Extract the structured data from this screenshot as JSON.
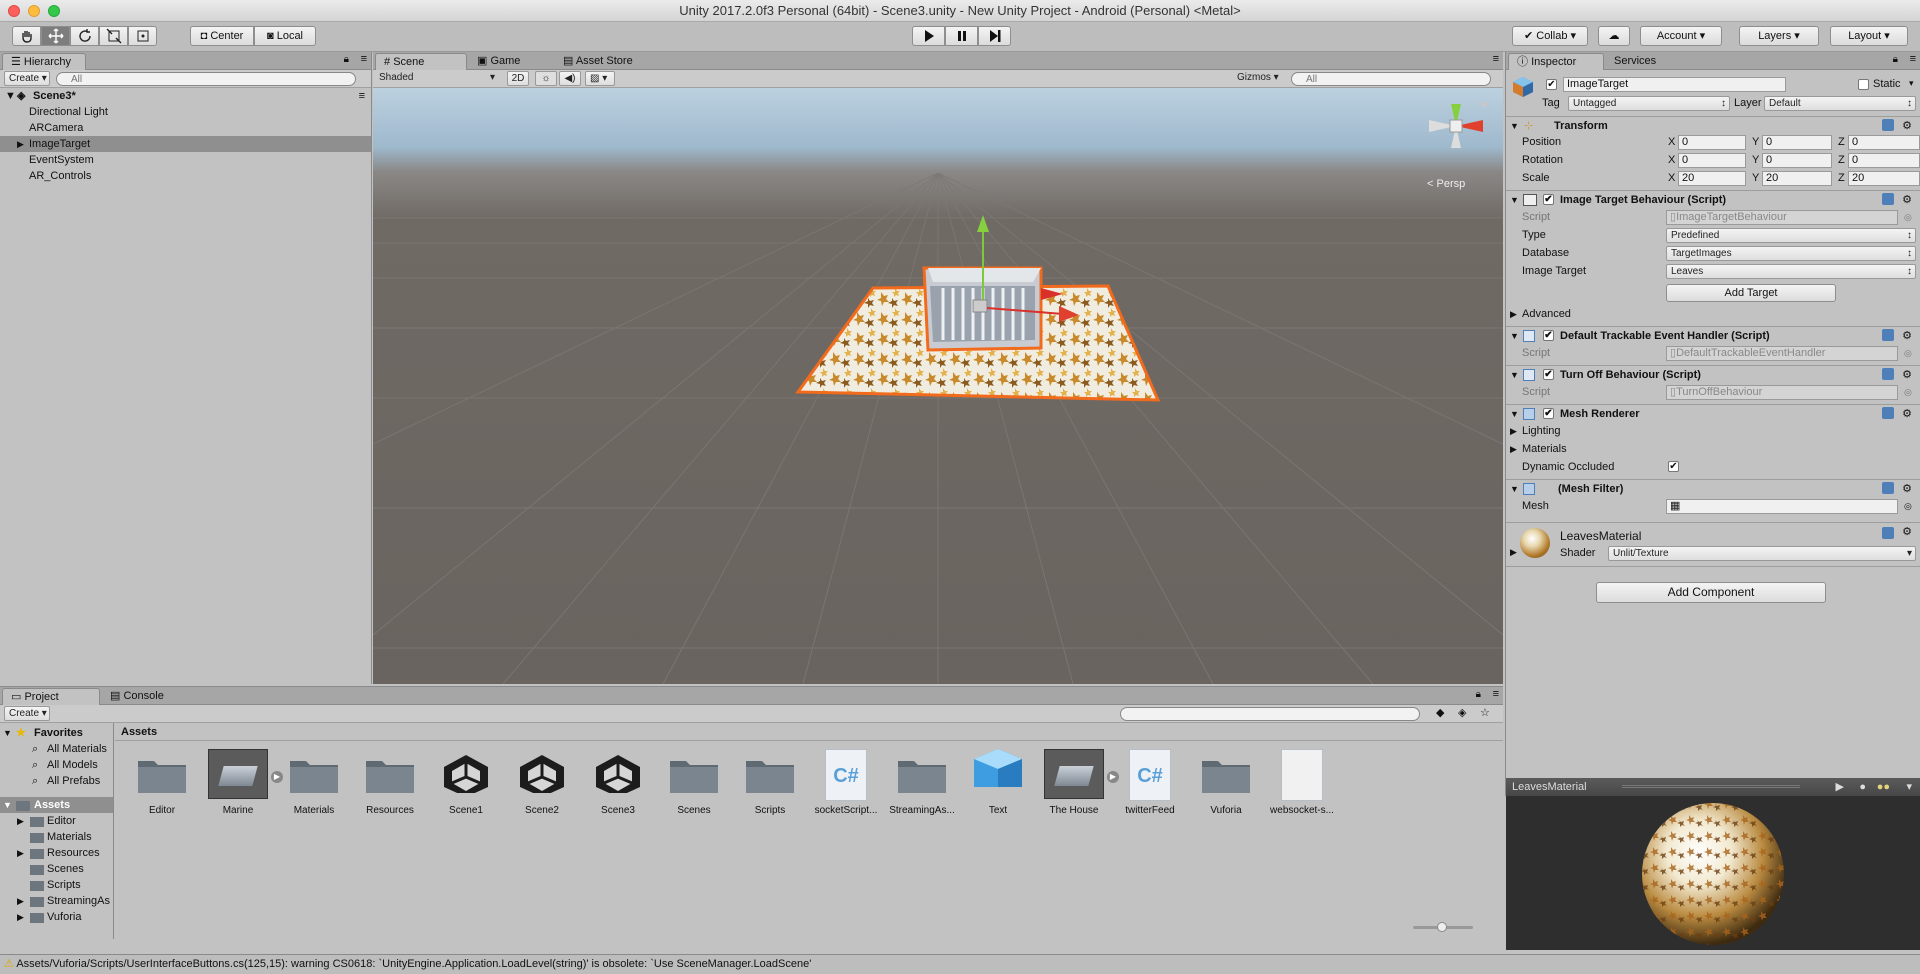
{
  "window": {
    "title": "Unity 2017.2.0f3 Personal (64bit) - Scene3.unity - New Unity Project - Android (Personal) <Metal>"
  },
  "toolbar": {
    "center": "Center",
    "local": "Local",
    "collab": "Collab",
    "account": "Account",
    "layers": "Layers",
    "layout": "Layout"
  },
  "hierarchy": {
    "tab": "Hierarchy",
    "create": "Create",
    "search_placeholder": "All",
    "scene": "Scene3*",
    "items": [
      "Directional Light",
      "ARCamera",
      "ImageTarget",
      "EventSystem",
      "AR_Controls"
    ]
  },
  "scene_view": {
    "tabs": [
      "Scene",
      "Game",
      "Asset Store"
    ],
    "shading": "Shaded",
    "mode_2d": "2D",
    "gizmos": "Gizmos",
    "search_placeholder": "All",
    "persp": "Persp"
  },
  "inspector": {
    "tabs": [
      "Inspector",
      "Services"
    ],
    "object_name": "ImageTarget",
    "static_label": "Static",
    "tag_label": "Tag",
    "tag_value": "Untagged",
    "layer_label": "Layer",
    "layer_value": "Default",
    "transform": {
      "title": "Transform",
      "position_label": "Position",
      "rotation_label": "Rotation",
      "scale_label": "Scale",
      "position": [
        "0",
        "0",
        "0"
      ],
      "rotation": [
        "0",
        "0",
        "0"
      ],
      "scale": [
        "20",
        "20",
        "20"
      ],
      "axes": [
        "X",
        "Y",
        "Z"
      ]
    },
    "image_target_behaviour": {
      "title": "Image Target Behaviour (Script)",
      "script_label": "Script",
      "script_value": "ImageTargetBehaviour",
      "type_label": "Type",
      "type_value": "Predefined",
      "database_label": "Database",
      "database_value": "TargetImages",
      "image_target_label": "Image Target",
      "image_target_value": "Leaves",
      "add_target": "Add Target",
      "advanced": "Advanced"
    },
    "default_trackable": {
      "title": "Default Trackable Event Handler (Script)",
      "script_label": "Script",
      "script_value": "DefaultTrackableEventHandler"
    },
    "turn_off": {
      "title": "Turn Off Behaviour (Script)",
      "script_label": "Script",
      "script_value": "TurnOffBehaviour"
    },
    "mesh_renderer": {
      "title": "Mesh Renderer",
      "lighting": "Lighting",
      "materials": "Materials",
      "dynamic_occluded": "Dynamic Occluded"
    },
    "mesh_filter": {
      "title": "(Mesh Filter)",
      "mesh_label": "Mesh"
    },
    "material": {
      "name": "LeavesMaterial",
      "shader_label": "Shader",
      "shader_value": "Unlit/Texture"
    },
    "add_component": "Add Component",
    "preview_title": "LeavesMaterial"
  },
  "project": {
    "tabs": [
      "Project",
      "Console"
    ],
    "create": "Create",
    "favorites_label": "Favorites",
    "favorites": [
      "All Materials",
      "All Models",
      "All Prefabs"
    ],
    "assets_label": "Assets",
    "asset_folders": [
      "Editor",
      "Materials",
      "Resources",
      "Scenes",
      "Scripts",
      "StreamingAs",
      "Vuforia"
    ],
    "breadcrumb": "Assets",
    "items": [
      {
        "name": "Editor",
        "kind": "folder"
      },
      {
        "name": "Marine",
        "kind": "model"
      },
      {
        "name": "Materials",
        "kind": "folder"
      },
      {
        "name": "Resources",
        "kind": "folder"
      },
      {
        "name": "Scene1",
        "kind": "unity"
      },
      {
        "name": "Scene2",
        "kind": "unity"
      },
      {
        "name": "Scene3",
        "kind": "unity"
      },
      {
        "name": "Scenes",
        "kind": "folder"
      },
      {
        "name": "Scripts",
        "kind": "folder"
      },
      {
        "name": "socketScript...",
        "kind": "cs"
      },
      {
        "name": "StreamingAs...",
        "kind": "folder"
      },
      {
        "name": "Text",
        "kind": "cube"
      },
      {
        "name": "The House",
        "kind": "model"
      },
      {
        "name": "twitterFeed",
        "kind": "cs"
      },
      {
        "name": "Vuforia",
        "kind": "folder"
      },
      {
        "name": "websocket-s...",
        "kind": "file"
      }
    ]
  },
  "status_bar": {
    "message": "Assets/Vuforia/Scripts/UserInterfaceButtons.cs(125,15): warning CS0618: `UnityEngine.Application.LoadLevel(string)' is obsolete: `Use SceneManager.LoadScene'"
  },
  "colors": {
    "selection": "#8f8f8f",
    "accent_orange": "#f26a1b",
    "sky": "#aec6d9",
    "ground": "#6e6863"
  }
}
